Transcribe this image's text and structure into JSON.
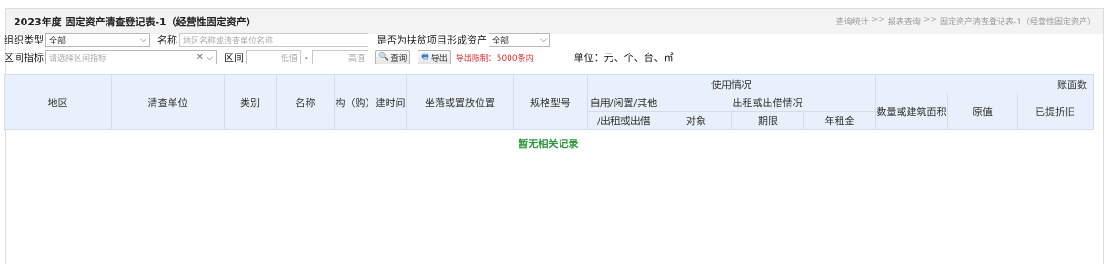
{
  "page": {
    "title": "2023年度 固定资产清查登记表-1（经营性固定资产）"
  },
  "breadcrumb": [
    "查询统计",
    ">>",
    "报表查询",
    ">>",
    "固定资产清查登记表-1（经营性固定资产）"
  ],
  "filters": {
    "org_type_label": "组织类型",
    "org_type_value": "全部",
    "name_label": "名称",
    "name_placeholder": "地区名称或清查单位名称",
    "poverty_label": "是否为扶贫项目形成资产",
    "poverty_value": "全部",
    "range_metric_label": "区间指标",
    "range_metric_placeholder": "请选择区间指标",
    "range_label": "区间",
    "min_placeholder": "低值",
    "range_dash": "-",
    "max_placeholder": "高值",
    "query_button": "查询",
    "export_button": "导出",
    "export_limit": "导出限制：5000条内",
    "unit_text": "单位：元、个、台、㎡"
  },
  "table": {
    "headers": {
      "region": "地区",
      "unit": "清查单位",
      "category": "类别",
      "name": "名称",
      "build_time": "构（购）建时间",
      "location": "坐落或置放位置",
      "spec": "规格型号",
      "usage": "使用情况",
      "self_use": "自用/闲置/其他",
      "rent_out": "/出租或出借",
      "rent_info": "出租或出借情况",
      "target": "对象",
      "term": "期限",
      "annual_rent": "年租金",
      "book": "账面数",
      "quantity": "数量或建筑面积",
      "original": "原值",
      "depreciation": "已提折旧"
    },
    "empty_text": "暂无相关记录"
  },
  "colors": {
    "header_bg": "#e8f1fb",
    "empty_text": "#2e9b3e",
    "limit_text": "#e03030"
  }
}
